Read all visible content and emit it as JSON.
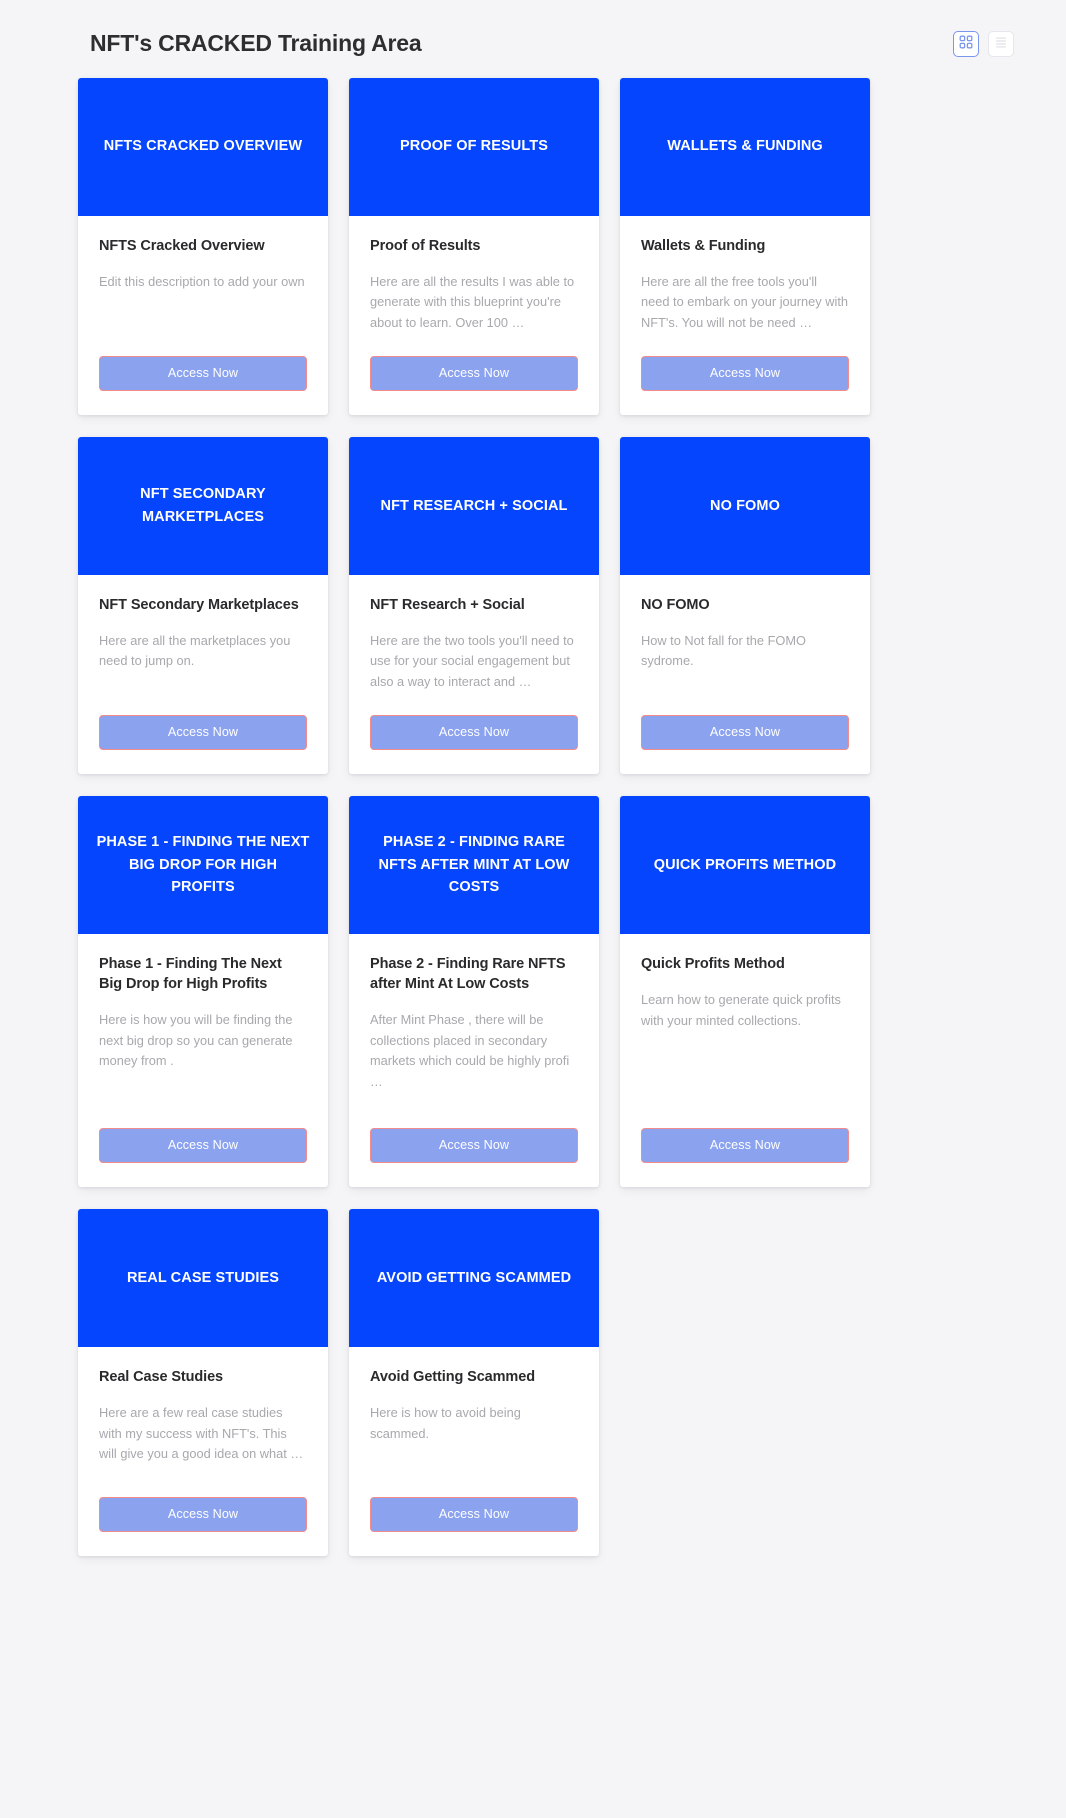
{
  "header": {
    "title": "NFT's CRACKED Training Area",
    "view_toggle": {
      "grid_label": "grid-view",
      "list_label": "list-view",
      "active": "grid"
    }
  },
  "theme": {
    "page_background": "#f5f5f7",
    "card_header_blue": "#0545fe",
    "card_background": "#ffffff",
    "title_color": "#2a2a2c",
    "description_color": "#a8a8ad",
    "button_fill": "#8ba2ef",
    "button_border": "#f28b8b",
    "toggle_active_border": "#7b96f0"
  },
  "cards": [
    {
      "banner": "NFTS CRACKED OVERVIEW",
      "title": "NFTS Cracked Overview",
      "description": "Edit this description to add your own",
      "button": "Access Now"
    },
    {
      "banner": "PROOF OF RESULTS",
      "title": "Proof of Results",
      "description": "Here are all the results I was able to generate with this blueprint you're about to learn. Over 100 …",
      "button": "Access Now"
    },
    {
      "banner": "WALLETS & FUNDING",
      "title": "Wallets & Funding",
      "description": "Here are all the free tools you'll need to embark on your journey with NFT's. You will not be need …",
      "button": "Access Now"
    },
    {
      "banner": "NFT SECONDARY MARKETPLACES",
      "title": "NFT Secondary Marketplaces",
      "description": "Here are all the marketplaces you need to jump on.",
      "button": "Access Now"
    },
    {
      "banner": "NFT RESEARCH + SOCIAL",
      "title": "NFT Research + Social",
      "description": "Here are the two tools you'll need to use for your social engagement but also a way to interact and …",
      "button": "Access Now"
    },
    {
      "banner": "NO FOMO",
      "title": "NO FOMO",
      "description": "How to Not fall for the FOMO sydrome.",
      "button": "Access Now"
    },
    {
      "banner": "PHASE 1 - FINDING THE NEXT BIG DROP FOR HIGH PROFITS",
      "title": "Phase 1 - Finding The Next Big Drop for High Profits",
      "description": "Here is how you will be finding the next big drop so you can generate money from .",
      "button": "Access Now"
    },
    {
      "banner": "PHASE 2 - FINDING RARE NFTS AFTER MINT AT LOW COSTS",
      "title": "Phase 2 - Finding Rare NFTS after Mint At Low Costs",
      "description": "After Mint Phase , there will be collections placed in secondary markets which could be highly profi …",
      "button": "Access Now"
    },
    {
      "banner": "QUICK PROFITS METHOD",
      "title": "Quick Profits Method",
      "description": "Learn how to generate quick profits with your minted collections.",
      "button": "Access Now"
    },
    {
      "banner": "REAL CASE STUDIES",
      "title": "Real Case Studies",
      "description": "Here are a few real case studies with my success with NFT's. This will give you a good idea on what …",
      "button": "Access Now"
    },
    {
      "banner": "AVOID GETTING SCAMMED",
      "title": "Avoid Getting Scammed",
      "description": "Here is how to avoid being scammed.",
      "button": "Access Now"
    }
  ]
}
